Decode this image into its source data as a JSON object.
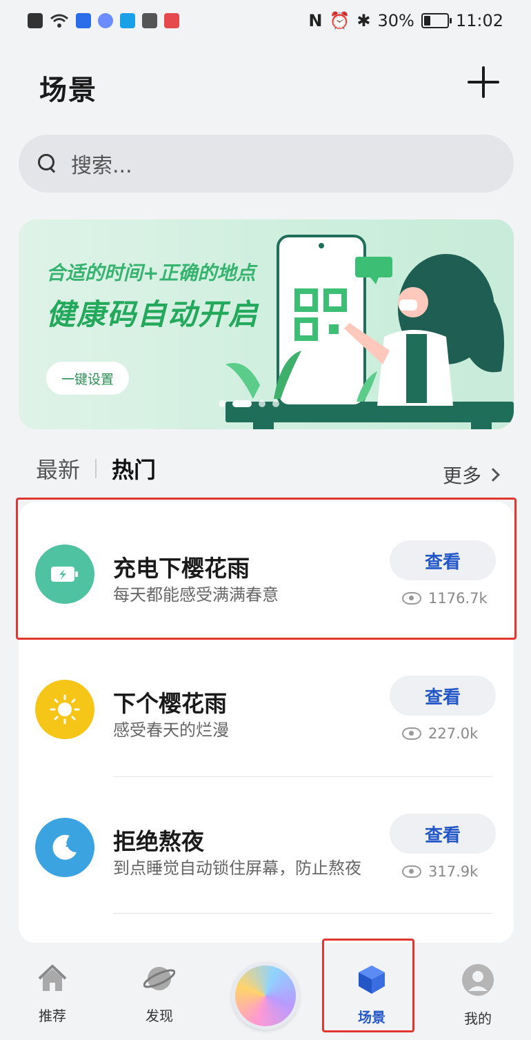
{
  "status_bar": {
    "battery_percent": "30%",
    "time": "11:02",
    "battery_level": 0.3
  },
  "header": {
    "title": "场景",
    "add_icon": "plus-icon"
  },
  "search": {
    "placeholder": "搜索..."
  },
  "banner": {
    "line1": "合适的时间+正确的地点",
    "line2": "健康码自动开启",
    "button_label": "一键设置",
    "dot_count": 4,
    "active_dot": 1
  },
  "tabs": {
    "items": [
      {
        "label": "最新",
        "active": false
      },
      {
        "label": "热门",
        "active": true
      }
    ],
    "more_label": "更多"
  },
  "scenes": [
    {
      "title": "充电下樱花雨",
      "desc": "每天都能感受满满春意",
      "button": "查看",
      "views": "1176.7k",
      "icon": "battery-charging-icon",
      "color": "#4fc3a1"
    },
    {
      "title": "下个樱花雨",
      "desc": "感受春天的烂漫",
      "button": "查看",
      "views": "227.0k",
      "icon": "sun-icon",
      "color": "#f5c518"
    },
    {
      "title": "拒绝熬夜",
      "desc": "到点睡觉自动锁住屏幕，防止熬夜",
      "button": "查看",
      "views": "317.9k",
      "icon": "moon-sleep-icon",
      "color": "#3aa3e0"
    }
  ],
  "bottom_nav": [
    {
      "label": "推荐",
      "icon": "home-icon",
      "active": false
    },
    {
      "label": "发现",
      "icon": "planet-icon",
      "active": false
    },
    {
      "label": "",
      "icon": "assistant-orb-icon",
      "active": false
    },
    {
      "label": "场景",
      "icon": "cube-icon",
      "active": true
    },
    {
      "label": "我的",
      "icon": "avatar-icon",
      "active": false
    }
  ],
  "colors": {
    "accent": "#2357c7",
    "highlight": "#e0362f",
    "banner_green": "#23a85c"
  }
}
